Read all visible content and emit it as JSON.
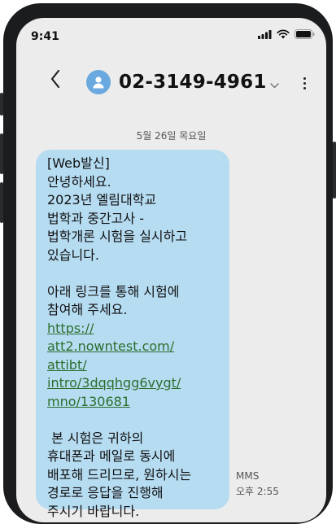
{
  "status_bar": {
    "time": "9:41",
    "icons": [
      "cellular-signal-icon",
      "wifi-icon",
      "battery-icon"
    ]
  },
  "header": {
    "back_icon": "chevron-left-icon",
    "avatar_icon": "person-icon",
    "contact_number": "02-3149-4961",
    "dropdown_icon": "chevron-down-icon",
    "more_icon": "more-vertical-icon"
  },
  "conversation": {
    "date_divider": "5월 26일 목요일",
    "message": {
      "lines_top": [
        "[Web발신]",
        "안녕하세요.",
        "2023년 엘림대학교",
        "법학과 중간고사 -",
        "법학개론 시험을 실시하고",
        "있습니다."
      ],
      "lines_mid": [
        "아래 링크를 통해 시험에",
        "참여해 주세요."
      ],
      "link_lines": [
        "https://",
        "att2.nowntest.com/",
        "attibt/",
        "intro/3dqqhgg6vygt/",
        "mno/130681"
      ],
      "lines_bottom": [
        " 본 시험은 귀하의",
        "휴대폰과 메일로 동시에",
        "배포해 드리므로, 원하시는",
        "경로로 응답을 진행해",
        "주시기 바랍니다."
      ]
    },
    "message_type": "MMS",
    "message_time": "오후 2:55"
  },
  "colors": {
    "bubble": "#b6dcf2",
    "link": "#2c6e2c",
    "avatar": "#6aa9e0",
    "screen_bg": "#ececec",
    "frame": "#1b1c1e"
  }
}
